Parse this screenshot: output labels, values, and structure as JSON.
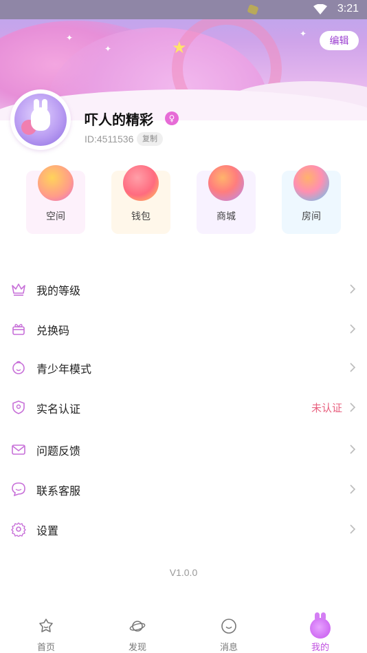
{
  "status_bar": {
    "time": "3:21"
  },
  "header": {
    "edit_label": "编辑"
  },
  "profile": {
    "name": "吓人的精彩",
    "gender_symbol": "♀",
    "id_text": "ID:4511536",
    "copy_label": "复制"
  },
  "quick_entries": [
    {
      "label": "空间",
      "icon": "emoji-face-icon"
    },
    {
      "label": "钱包",
      "icon": "wallet-icon"
    },
    {
      "label": "商城",
      "icon": "store-icon"
    },
    {
      "label": "房间",
      "icon": "microphone-icon"
    }
  ],
  "menu": [
    {
      "label": "我的等级",
      "icon": "crown-icon",
      "value": ""
    },
    {
      "label": "兑换码",
      "icon": "gift-icon",
      "value": ""
    },
    {
      "label": "青少年模式",
      "icon": "child-face-icon",
      "value": ""
    },
    {
      "label": "实名认证",
      "icon": "shield-icon",
      "value": "未认证"
    },
    {
      "label": "问题反馈",
      "icon": "mail-icon",
      "value": ""
    },
    {
      "label": "联系客服",
      "icon": "chat-icon",
      "value": ""
    },
    {
      "label": "设置",
      "icon": "gear-icon",
      "value": ""
    }
  ],
  "version": "V1.0.0",
  "tabbar": [
    {
      "label": "首页",
      "icon": "home-icon"
    },
    {
      "label": "发现",
      "icon": "planet-icon"
    },
    {
      "label": "消息",
      "icon": "message-icon"
    },
    {
      "label": "我的",
      "icon": "bunny-icon",
      "active": true
    }
  ],
  "colors": {
    "accent": "#c050e0",
    "warning": "#e8607f"
  }
}
